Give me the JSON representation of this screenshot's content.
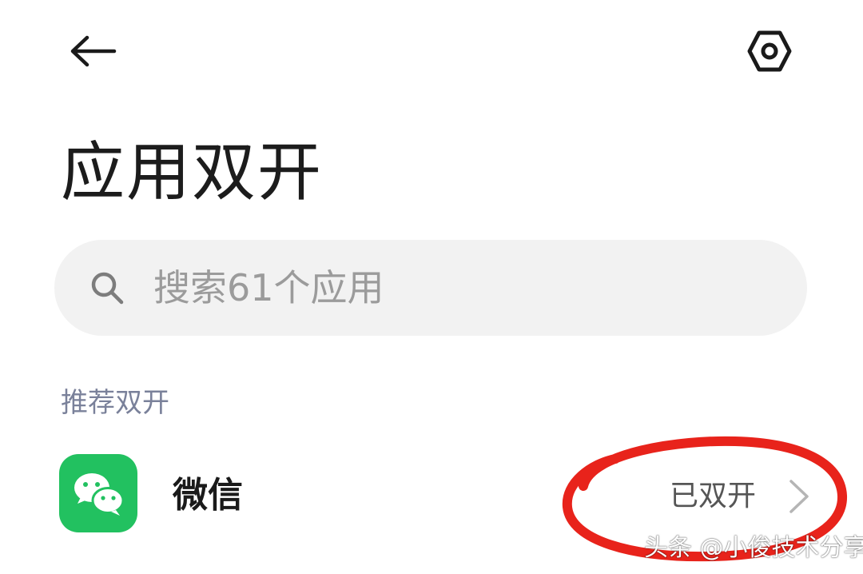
{
  "header": {
    "back_icon": "arrow-left-icon",
    "settings_icon": "hexagon-gear-icon"
  },
  "page": {
    "title": "应用双开"
  },
  "search": {
    "placeholder": "搜索61个应用",
    "icon": "search-icon"
  },
  "sections": [
    {
      "header": "推荐双开",
      "apps": [
        {
          "name": "微信",
          "status": "已双开",
          "icon": "wechat-icon"
        }
      ]
    }
  ],
  "watermark": {
    "text": "头条 @小俊技术分享"
  },
  "colors": {
    "wechat_green": "#22c160",
    "annotation_red": "#e8231b",
    "section_header": "#7a819a",
    "search_background": "#f2f2f2"
  }
}
